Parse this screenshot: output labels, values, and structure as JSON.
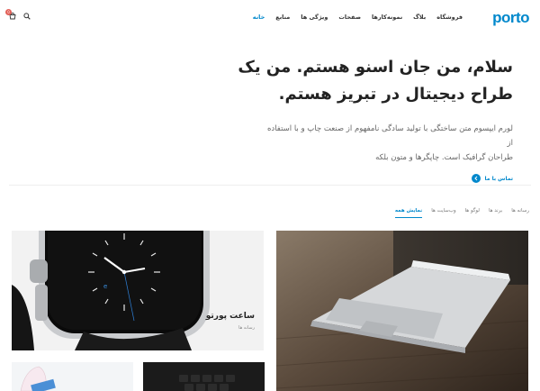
{
  "header": {
    "logo": "porto",
    "nav": [
      "خانه",
      "منابع",
      "ویژگی ها",
      "صفحات",
      "نمونه‌کارها",
      "بلاگ",
      "فروشگاه"
    ],
    "cart_count": "0"
  },
  "hero": {
    "title_line1": "سلام، من جان اسنو هستم. من یک",
    "title_line2": "طراح دیجیتال در تبریز هستم.",
    "text_line1": "لورم ایپسوم متن ساختگی با تولید سادگی نامفهوم از صنعت چاپ و با استفاده از",
    "text_line2": "طراحان گرافیک است. چاپگرها و متون بلکه",
    "contact_label": "تماس با ما"
  },
  "tabs": [
    "نمایش همه",
    "وب‌سایت ها",
    "لوگو ها",
    "برند ها",
    "رسانه ها"
  ],
  "portfolio": {
    "watch_title": "ساعت پورتو",
    "watch_sub": "رسانه ها"
  },
  "colors": {
    "accent": "#0088cc",
    "badge": "#e36159"
  }
}
